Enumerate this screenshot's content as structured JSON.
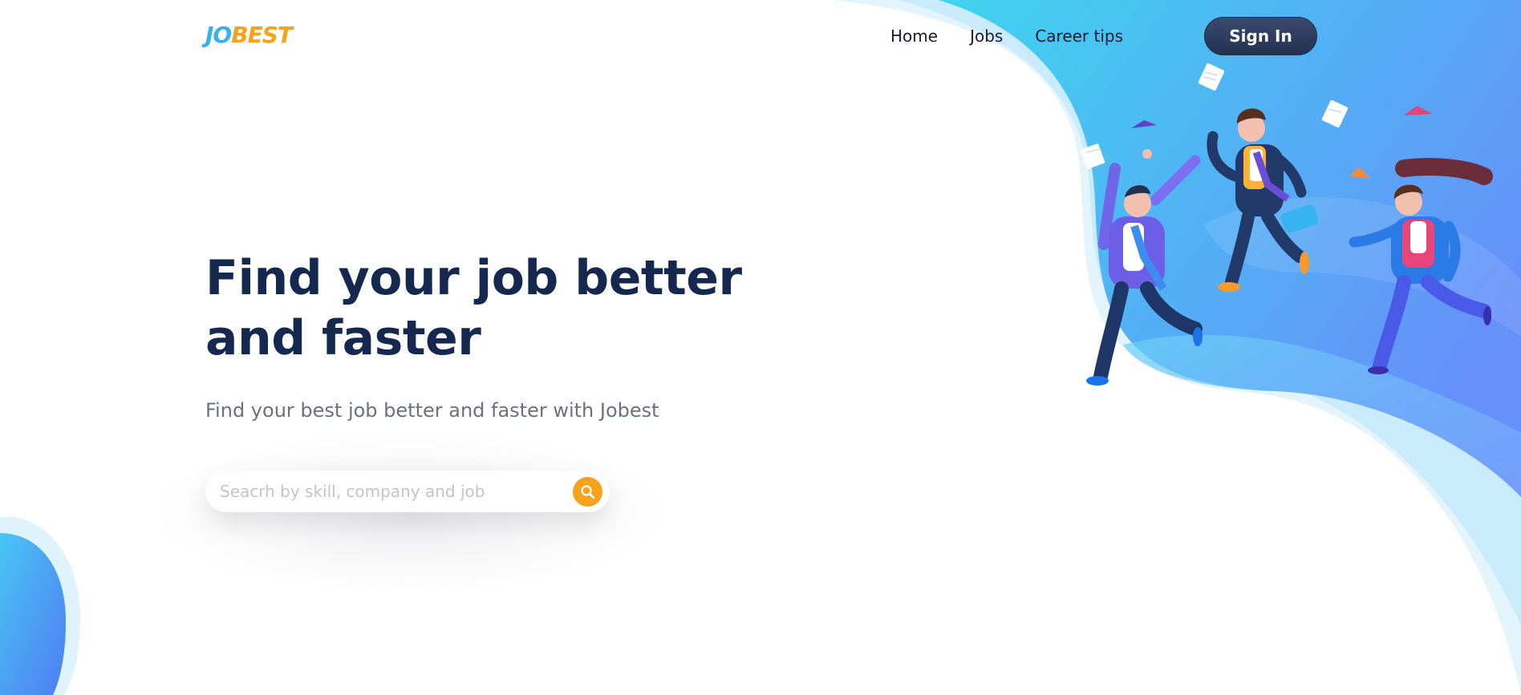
{
  "brand": {
    "logo_part1": "JO",
    "logo_part2": "BEST",
    "logo_color1": "#3ab0ea",
    "logo_color2": "#f7a21b"
  },
  "nav": {
    "items": [
      {
        "label": "Home"
      },
      {
        "label": "Jobs"
      },
      {
        "label": "Career tips"
      }
    ],
    "signin_label": "Sign In"
  },
  "hero": {
    "title_line1": "Find your job better",
    "title_line2": "and faster",
    "subtitle": "Find your best job better and faster with Jobest"
  },
  "search": {
    "placeholder": "Seacrh by skill, company and job",
    "value": "",
    "button_icon": "search-icon",
    "button_color": "#f7a21b"
  },
  "colors": {
    "title": "#142850",
    "subtitle": "#6f6f7d",
    "blob_light": "#43d2f0",
    "blob_dark": "#5b8af5",
    "signin_bg": "#2c3a5c"
  }
}
